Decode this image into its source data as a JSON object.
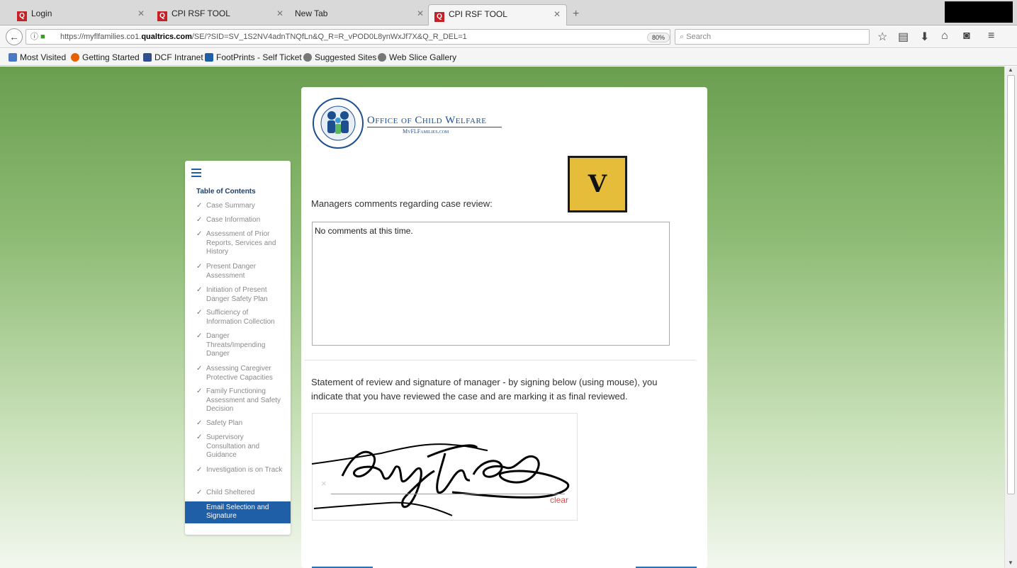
{
  "browser": {
    "tabs": [
      {
        "label": "Login"
      },
      {
        "label": "CPI RSF TOOL"
      },
      {
        "label": "New Tab"
      },
      {
        "label": "CPI RSF TOOL",
        "active": true
      }
    ],
    "url_prefix": "https://myflfamilies.co1.",
    "url_domain": "qualtrics.com",
    "url_path": "/SE/?SID=SV_1S2NV4adnTNQfLn&Q_R=R_vPOD0L8ynWxJf7X&Q_R_DEL=1",
    "zoom": "80%",
    "search_placeholder": "Search",
    "bookmarks": [
      {
        "label": "Most Visited",
        "color": "#4a79c4"
      },
      {
        "label": "Getting Started",
        "color": "#e66000"
      },
      {
        "label": "DCF Intranet",
        "color": "#2f4f8f"
      },
      {
        "label": "FootPrints - Self Ticket",
        "color": "#1f5fa8"
      },
      {
        "label": "Suggested Sites",
        "color": "#777777"
      },
      {
        "label": "Web Slice Gallery",
        "color": "#777777"
      }
    ]
  },
  "header": {
    "org_title": "Office of Child Welfare",
    "org_site": "MyFLFamilies.com"
  },
  "badge": {
    "letter": "V",
    "color": "#e5bd3b"
  },
  "toc": {
    "title": "Table of Contents",
    "items": [
      {
        "label": "Case Summary"
      },
      {
        "label": "Case Information"
      },
      {
        "label": "Assessment of Prior Reports, Services and History"
      },
      {
        "label": "Present Danger Assessment"
      },
      {
        "label": "Initiation of Present Danger Safety Plan"
      },
      {
        "label": "Sufficiency of Information Collection"
      },
      {
        "label": "Danger Threats/Impending Danger"
      },
      {
        "label": "Assessing Caregiver Protective Capacities"
      },
      {
        "label": "Family Functioning Assessment and Safety Decision"
      },
      {
        "label": "Safety Plan"
      },
      {
        "label": "Supervisory Consultation and Guidance"
      },
      {
        "label": "Investigation is on Track"
      },
      {
        "label": "Child Sheltered"
      }
    ],
    "active_item": "Email Selection and Signature"
  },
  "form": {
    "q1_label": "Managers comments regarding case review:",
    "q1_value": "No comments at this time.",
    "q2_label": "Statement of review and signature of manager - by signing below (using mouse), you indicate that you have reviewed the case and are marking it as final reviewed.",
    "sig_x": "×",
    "sig_clear": "clear"
  },
  "colors": {
    "accent": "#1f5fa8",
    "background_top": "#6a9e4f",
    "clear_link": "#d9534f"
  }
}
